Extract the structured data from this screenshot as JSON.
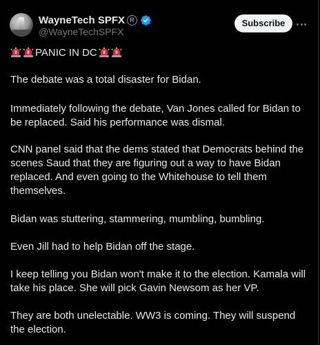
{
  "author": {
    "display_name": "WayneTech SPFX",
    "registered_mark": "R",
    "handle": "@WayneTechSPFX"
  },
  "actions": {
    "subscribe_label": "Subscribe"
  },
  "tweet": {
    "headline": "PANIC IN DC",
    "paragraphs": [
      "The debate was a total disaster for Bidan.",
      "Immediately following the debate, Van Jones called for Bidan to be replaced. Said his performance was dismal.",
      "CNN panel said that the dems stated that Democrats behind the scenes Saud that they are figuring out a way to have Bidan replaced. And even going to the Whitehouse to tell them themselves.",
      "Bidan was stuttering, stammering, mumbling, bumbling.",
      "Even Jill had to help Bidan off the stage.",
      "I keep telling you Bidan won't make it to the election. Kamala will take his place. She will pick Gavin Newsom as her VP.",
      "They are both unelectable. WW3 is coming. They will suspend the election."
    ]
  },
  "icons": {
    "avatar": "avatar-icon",
    "verified": "verified-badge-icon",
    "siren": "police-siren-icon",
    "more": "more-options-icon"
  },
  "colors": {
    "background": "#000000",
    "text": "#e7e9ea",
    "secondary_text": "#71767b",
    "verified": "#1d9bf0",
    "subscribe_bg": "#eff3f4",
    "siren_red": "#e0263c"
  }
}
